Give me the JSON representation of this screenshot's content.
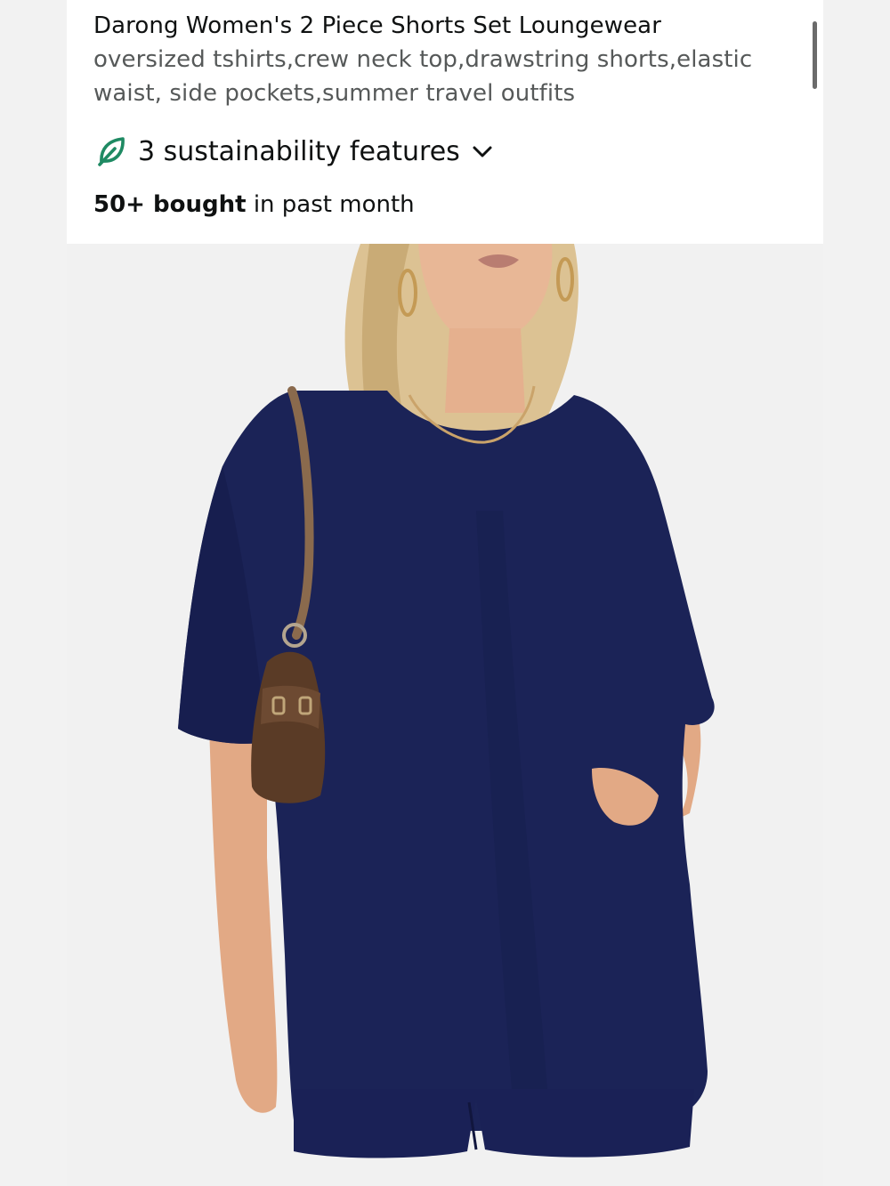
{
  "product": {
    "title_main": "Darong Women's 2 Piece Shorts Set Loungewear",
    "title_desc": "oversized tshirts,crew neck top,drawstring shorts,elastic waist, side pockets,summer travel outfits",
    "sustainability_label": "3 sustainability features",
    "sustainability_icon": "leaf-icon",
    "expand_icon": "chevron-down-icon",
    "bought_count": "50+ bought",
    "bought_suffix": "in past month"
  },
  "image": {
    "alt": "Woman wearing a navy oversized t-shirt and matching shorts with a brown shoulder bag"
  },
  "colors": {
    "leaf_green": "#1f8a63",
    "navy": "#1b2357",
    "muted_text": "#565959"
  }
}
